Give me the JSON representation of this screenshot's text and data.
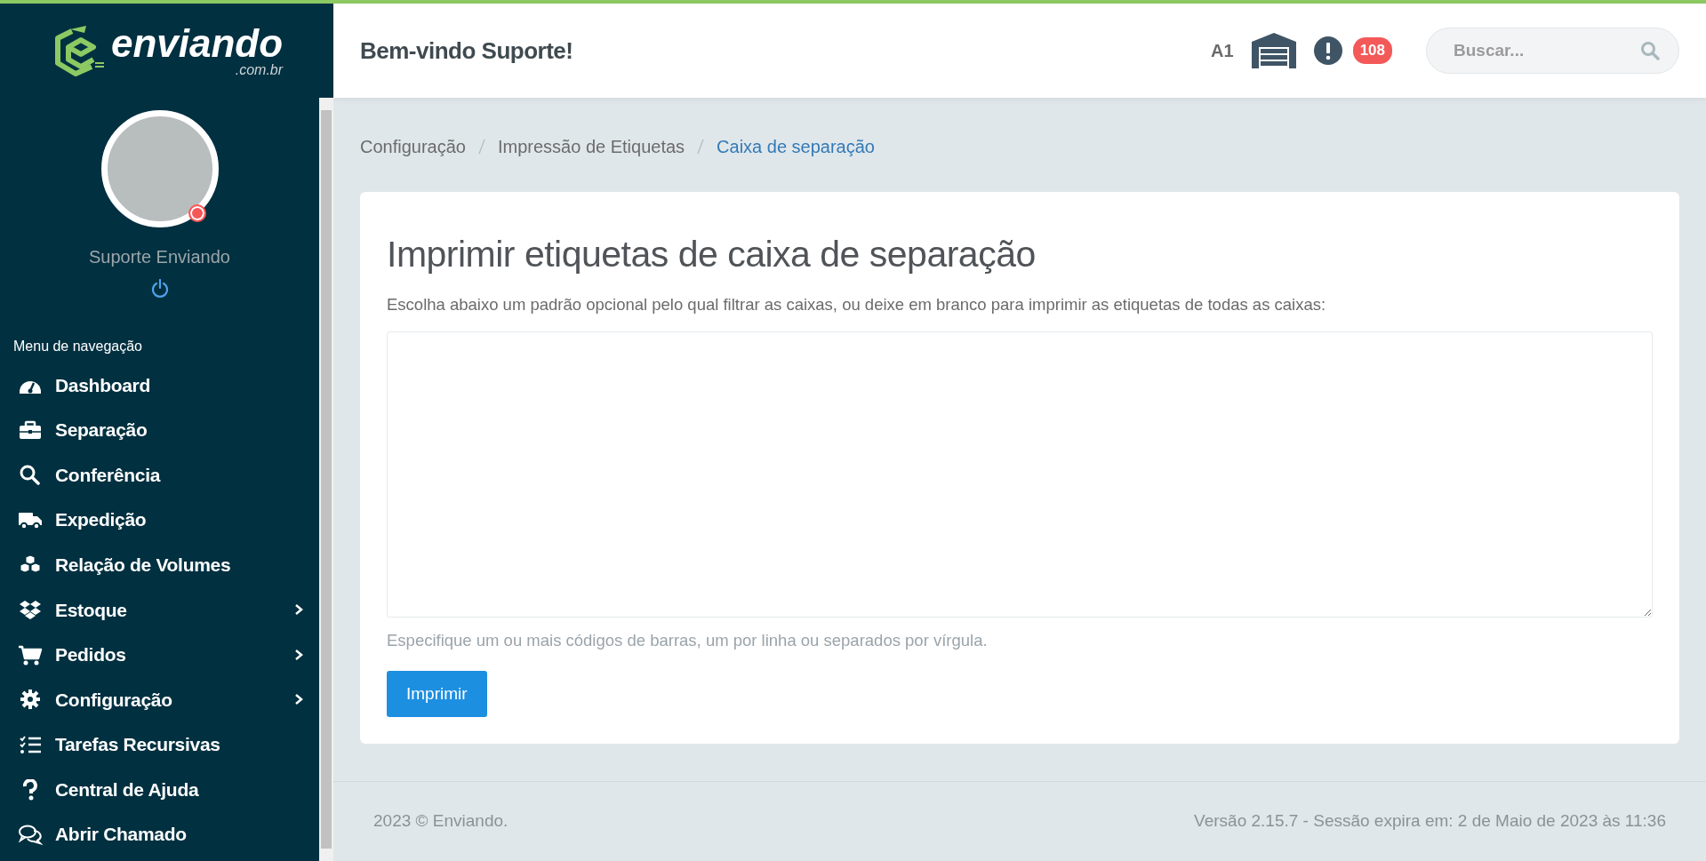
{
  "logo": {
    "name": "enviando",
    "domain": ".com.br"
  },
  "user": {
    "name": "Suporte Enviando",
    "offline": true
  },
  "sidebar": {
    "heading": "Menu de navegação",
    "items": [
      {
        "label": "Dashboard",
        "has_children": false
      },
      {
        "label": "Separação",
        "has_children": false
      },
      {
        "label": "Conferência",
        "has_children": false
      },
      {
        "label": "Expedição",
        "has_children": false
      },
      {
        "label": "Relação de Volumes",
        "has_children": false
      },
      {
        "label": "Estoque",
        "has_children": true
      },
      {
        "label": "Pedidos",
        "has_children": true
      },
      {
        "label": "Configuração",
        "has_children": true
      },
      {
        "label": "Tarefas Recursivas",
        "has_children": false
      },
      {
        "label": "Central de Ajuda",
        "has_children": false
      },
      {
        "label": "Abrir Chamado",
        "has_children": false
      }
    ]
  },
  "header": {
    "welcome": "Bem-vindo Suporte!",
    "warehouse_code": "A1",
    "alert_count": "108",
    "search": {
      "placeholder": "Buscar..."
    }
  },
  "breadcrumb": [
    {
      "label": "Configuração",
      "selected": false
    },
    {
      "label": "Impressão de Etiquetas",
      "selected": false
    },
    {
      "label": "Caixa de separação",
      "selected": true
    }
  ],
  "form": {
    "title": "Imprimir etiquetas de caixa de separação",
    "description": "Escolha abaixo um padrão opcional pelo qual filtrar as caixas, ou deixe em branco para imprimir as etiquetas de todas as caixas:",
    "help": "Especifique um ou mais códigos de barras, um por linha ou separados por vírgula.",
    "button": "Imprimir"
  },
  "footer": {
    "copyright": "2023 © Enviando.",
    "session": "Versão 2.15.7 - Sessão expira em: 2 de Maio de 2023 às 11:36"
  }
}
